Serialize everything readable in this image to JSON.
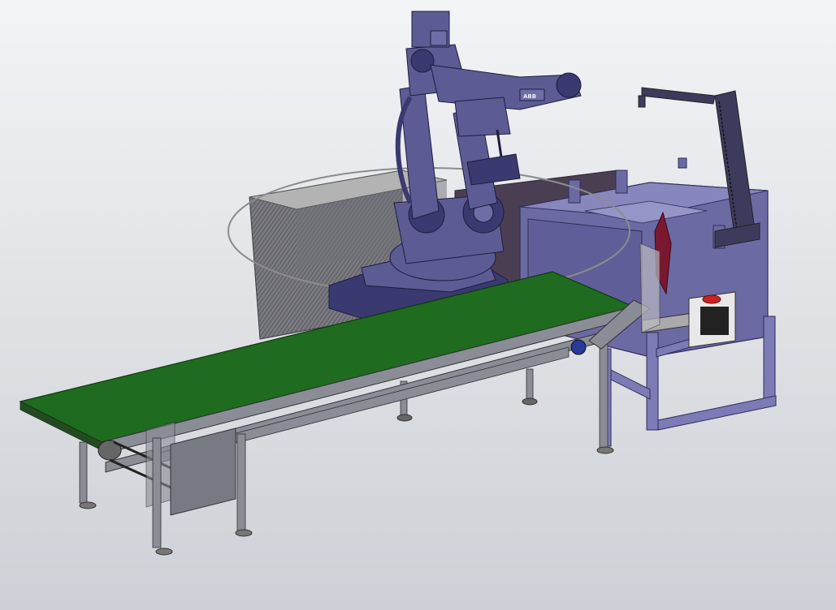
{
  "viewport": {
    "background_top": "#f3f4f6",
    "background_bottom": "#cdd0d6"
  },
  "robot": {
    "brand_label": "ABB",
    "color": "#5c5b93",
    "dark_color": "#3a3970"
  },
  "conveyor": {
    "belt_color": "#1f6b1f",
    "frame_color": "#8a8d96"
  },
  "stack": {
    "top_color": "#b3b3b3",
    "side_color": "#6a6a70"
  },
  "machine": {
    "color": "#6b6aa3",
    "frame_color": "#7c7bb5"
  },
  "overlays": {
    "reach_circle_color": "#8c8c8c",
    "stop_button_color": "#cc2222"
  }
}
